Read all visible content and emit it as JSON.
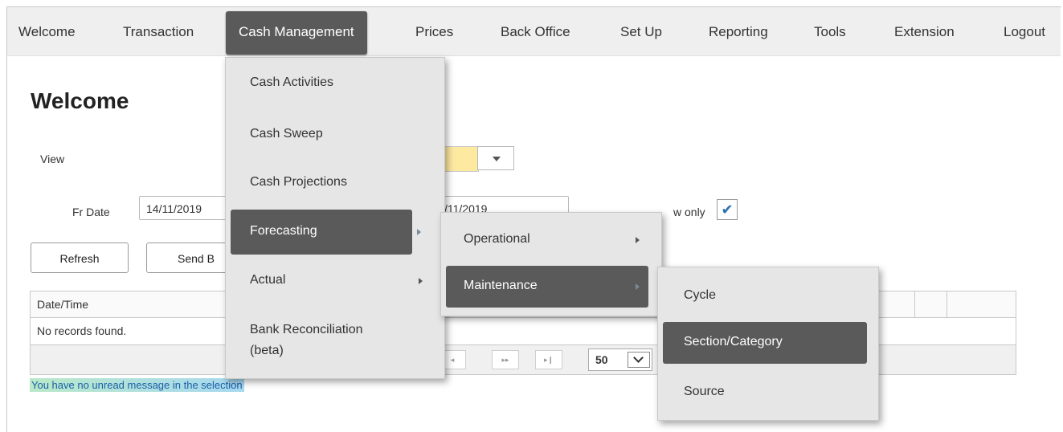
{
  "nav": {
    "items": [
      "Welcome",
      "Transaction",
      "Cash Management",
      "Prices",
      "Back Office",
      "Set Up",
      "Reporting",
      "Tools",
      "Extension",
      "Logout"
    ]
  },
  "page": {
    "title": "Welcome",
    "view_label": "View",
    "fr_date_label": "Fr Date",
    "fr_date_value": "14/11/2019",
    "to_date_value": "/11/2019",
    "view_new_only_label": "w only",
    "refresh_label": "Refresh",
    "send_label": "Send B"
  },
  "grid": {
    "header_datetime": "Date/Time",
    "empty_text": "No records found.",
    "page_size": "50",
    "prev_glyph": "◂",
    "next_glyph": "▸▸",
    "last_glyph": "▸❙"
  },
  "message": "You have no unread message in the selection",
  "menus": {
    "cash_management": [
      "Cash Activities",
      "Cash Sweep",
      "Cash Projections",
      "Forecasting",
      "Actual",
      "Bank Reconciliation",
      "(beta)"
    ],
    "forecasting": [
      "Operational",
      "Maintenance"
    ],
    "maintenance": [
      "Cycle",
      "Section/Category",
      "Source"
    ]
  },
  "colors": {
    "nav_active": "#5a5a5a",
    "menu_bg": "#e6e6e6",
    "highlight": "#5a5a5a",
    "select_yellow": "#fde9a0"
  },
  "icons": {
    "checkbox": "checkmark-icon",
    "submenu": "chevron-right-icon",
    "dropdown": "chevron-down-icon"
  }
}
